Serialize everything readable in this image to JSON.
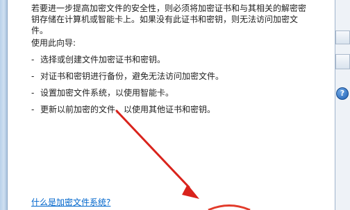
{
  "intro_text": "若要进一步提高加密文件的安全性，则必须将加密证书和与其相关的解密密钥存储在计算机或智能卡上。如果没有此证书和密钥，则无法访问加密文件。",
  "guide_title": "使用此向导:",
  "steps": [
    {
      "dash": "-",
      "text": "选择或创建文件加密证书和密钥。"
    },
    {
      "dash": "-",
      "text": "对证书和密钥进行备份，避免无法访问加密文件。"
    },
    {
      "dash": "-",
      "text": "设置加密文件系统，以使用智能卡。"
    },
    {
      "dash": "-",
      "text": "更新以前加密的文件，以使用其他证书和密钥。"
    }
  ],
  "help_link": "什么是加密文件系统?",
  "side_icon": "?",
  "colors": {
    "link": "#0066cc",
    "annotation_arrow": "#d9231c"
  },
  "icons": {
    "help": "help-question-icon",
    "annotation": "red-arrow-annotation"
  }
}
